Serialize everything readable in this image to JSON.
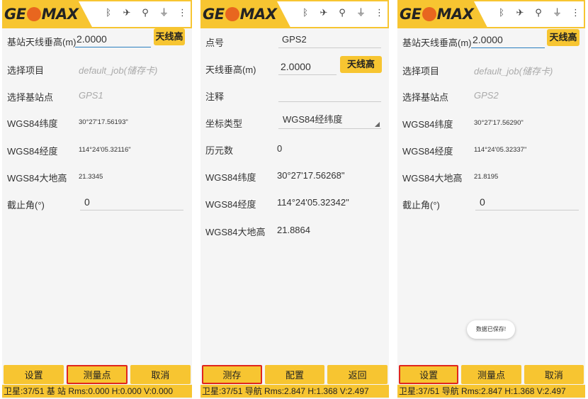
{
  "panels": [
    {
      "logo": "GEOMAX",
      "antenna_label": "基站天线垂高(m)",
      "antenna_value": "2.0000",
      "antenna_button": "天线高",
      "project_label": "选择项目",
      "project_value": "default_job(储存卡)",
      "base_label": "选择基站点",
      "base_value": "GPS1",
      "lat_label": "WGS84纬度",
      "lat_value": "30°27'17.56193\"",
      "lon_label": "WGS84经度",
      "lon_value": "114°24'05.32116\"",
      "h_label": "WGS84大地高",
      "h_value": "21.3345",
      "cutoff_label": "截止角(°)",
      "cutoff_value": "0",
      "btn_left": "设置",
      "btn_mid": "测量点",
      "btn_right": "取消",
      "status": "卫星:37/51 基 站 Rms:0.000 H:0.000 V:0.000"
    },
    {
      "logo": "GEOMAX",
      "point_label": "点号",
      "point_value": "GPS2",
      "antenna_label": "天线垂高(m)",
      "antenna_value": "2.0000",
      "antenna_button": "天线高",
      "note_label": "注释",
      "note_value": "",
      "coord_label": "坐标类型",
      "coord_value": "WGS84经纬度",
      "epoch_label": "历元数",
      "epoch_value": "0",
      "lat_label": "WGS84纬度",
      "lat_value": "30°27'17.56268\"",
      "lon_label": "WGS84经度",
      "lon_value": "114°24'05.32342\"",
      "h_label": "WGS84大地高",
      "h_value": "21.8864",
      "btn_left": "测存",
      "btn_mid": "配置",
      "btn_right": "返回",
      "status": "卫星:37/51 导航 Rms:2.847 H:1.368 V:2.497"
    },
    {
      "logo": "GEOMAX",
      "antenna_label": "基站天线垂高(m)",
      "antenna_value": "2.0000",
      "antenna_button": "天线高",
      "project_label": "选择项目",
      "project_value": "default_job(储存卡)",
      "base_label": "选择基站点",
      "base_value": "GPS2",
      "lat_label": "WGS84纬度",
      "lat_value": "30°27'17.56290\"",
      "lon_label": "WGS84经度",
      "lon_value": "114°24'05.32337\"",
      "h_label": "WGS84大地高",
      "h_value": "21.8195",
      "cutoff_label": "截止角(°)",
      "cutoff_value": "0",
      "toast": "数据已保存!",
      "btn_left": "设置",
      "btn_mid": "测量点",
      "btn_right": "取消",
      "status": "卫星:37/51 导航 Rms:2.847 H:1.368 V:2.497"
    }
  ],
  "status_icons": [
    "bluetooth-icon",
    "satellite-icon",
    "gnss-antenna-icon",
    "radio-tower-icon",
    "more-vertical-icon"
  ],
  "colors": {
    "brand_yellow": "#f7c531",
    "logo_orange": "#e8661f",
    "highlight_red": "#e0261d",
    "active_underline": "#2a7fc0"
  }
}
